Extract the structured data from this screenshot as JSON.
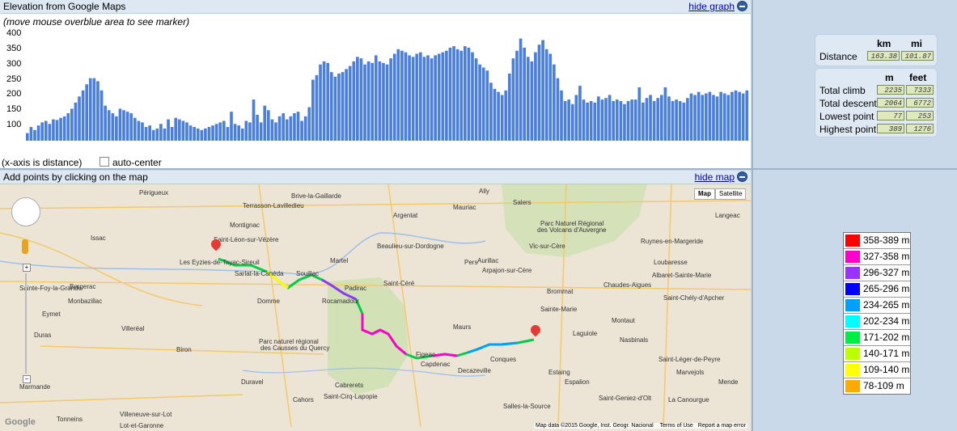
{
  "elevation": {
    "title": "Elevation from Google Maps",
    "hide_link": "hide graph",
    "hint": "(move mouse overblue area to see marker)",
    "y_ticks": [
      "400",
      "350",
      "300",
      "250",
      "200",
      "150",
      "100"
    ],
    "x_note": "(x-axis is distance)",
    "autocenter_label": "auto-center",
    "bar_color": "#4a7fe0",
    "chart_data": {
      "type": "bar",
      "ylim": [
        50,
        400
      ],
      "values": [
        75,
        95,
        85,
        100,
        110,
        115,
        105,
        120,
        118,
        125,
        130,
        140,
        155,
        175,
        195,
        215,
        235,
        255,
        255,
        245,
        215,
        165,
        150,
        140,
        130,
        155,
        150,
        145,
        140,
        125,
        115,
        110,
        95,
        100,
        85,
        90,
        105,
        90,
        120,
        95,
        125,
        120,
        115,
        110,
        100,
        95,
        90,
        85,
        90,
        95,
        100,
        105,
        110,
        115,
        95,
        145,
        105,
        100,
        90,
        115,
        110,
        185,
        135,
        110,
        165,
        150,
        120,
        110,
        130,
        140,
        120,
        130,
        140,
        145,
        115,
        130,
        160,
        250,
        265,
        300,
        310,
        305,
        275,
        260,
        270,
        275,
        285,
        295,
        310,
        325,
        320,
        300,
        310,
        305,
        330,
        310,
        305,
        300,
        320,
        335,
        350,
        345,
        340,
        330,
        325,
        335,
        340,
        325,
        330,
        320,
        330,
        335,
        340,
        345,
        355,
        360,
        350,
        345,
        360,
        355,
        340,
        320,
        300,
        290,
        280,
        240,
        220,
        210,
        200,
        215,
        270,
        320,
        345,
        385,
        355,
        325,
        310,
        340,
        365,
        380,
        350,
        335,
        300,
        255,
        215,
        180,
        185,
        170,
        200,
        230,
        185,
        175,
        180,
        175,
        195,
        185,
        190,
        200,
        180,
        185,
        180,
        170,
        180,
        185,
        185,
        225,
        175,
        190,
        200,
        180,
        190,
        200,
        225,
        195,
        180,
        185,
        180,
        175,
        190,
        205,
        200,
        210,
        200,
        205,
        210,
        200,
        195,
        210,
        205,
        200,
        210,
        215,
        210,
        205,
        215
      ]
    }
  },
  "stats": {
    "col_km": "km",
    "col_mi": "mi",
    "distance_label": "Distance",
    "distance_km": "163.38",
    "distance_mi": "101.87",
    "col_m": "m",
    "col_feet": "feet",
    "rows": [
      {
        "label": "Total climb",
        "m": "2235",
        "ft": "7333"
      },
      {
        "label": "Total descent",
        "m": "2064",
        "ft": "6772"
      },
      {
        "label": "Lowest point",
        "m": "77",
        "ft": "253"
      },
      {
        "label": "Highest point",
        "m": "389",
        "ft": "1276"
      }
    ]
  },
  "map": {
    "title": "Add points by clicking on the map",
    "hide_link": "hide map",
    "btn_map": "Map",
    "btn_satellite": "Satellite",
    "attribution": "Map data ©2015 Google, Inst. Geogr. Nacional",
    "terms": "Terms of Use",
    "report": "Report a map error",
    "google": "Google",
    "places": [
      {
        "name": "Périgueux",
        "x": 172,
        "y": 6
      },
      {
        "name": "Brive-la-Gaillarde",
        "x": 360,
        "y": 10
      },
      {
        "name": "Ally",
        "x": 592,
        "y": 4
      },
      {
        "name": "Salers",
        "x": 634,
        "y": 18
      },
      {
        "name": "Terrasson-Lavilledieu",
        "x": 300,
        "y": 22
      },
      {
        "name": "Argentat",
        "x": 486,
        "y": 34
      },
      {
        "name": "Mauriac",
        "x": 560,
        "y": 24
      },
      {
        "name": "Langeac",
        "x": 884,
        "y": 34
      },
      {
        "name": "Montignac",
        "x": 284,
        "y": 46
      },
      {
        "name": "Parc Naturel Régional",
        "x": 668,
        "y": 44
      },
      {
        "name": "des Volcans d'Auvergne",
        "x": 664,
        "y": 52
      },
      {
        "name": "Issac",
        "x": 112,
        "y": 62
      },
      {
        "name": "Saint-Léon-sur-Vézère",
        "x": 264,
        "y": 64
      },
      {
        "name": "Beaulieu-sur-Dordogne",
        "x": 466,
        "y": 72
      },
      {
        "name": "Vic-sur-Cère",
        "x": 654,
        "y": 72
      },
      {
        "name": "Ruynes-en-Margeride",
        "x": 792,
        "y": 66
      },
      {
        "name": "Les Eyzies-de-Tayac-Sireuil",
        "x": 222,
        "y": 92
      },
      {
        "name": "Sarlat-la-Canéda",
        "x": 290,
        "y": 106
      },
      {
        "name": "Martel",
        "x": 408,
        "y": 90
      },
      {
        "name": "Aurillac",
        "x": 590,
        "y": 90
      },
      {
        "name": "Arpajon-sur-Cère",
        "x": 596,
        "y": 102
      },
      {
        "name": "Loubaresse",
        "x": 808,
        "y": 92
      },
      {
        "name": "Souillac",
        "x": 366,
        "y": 106
      },
      {
        "name": "Pers",
        "x": 574,
        "y": 92
      },
      {
        "name": "Albaret-Sainte-Marie",
        "x": 806,
        "y": 108
      },
      {
        "name": "Bergerac",
        "x": 86,
        "y": 122
      },
      {
        "name": "Sainte-Foy-la-Grande",
        "x": 24,
        "y": 124
      },
      {
        "name": "Saint-Céré",
        "x": 474,
        "y": 118
      },
      {
        "name": "Padirac",
        "x": 426,
        "y": 124
      },
      {
        "name": "Chaudes-Aigues",
        "x": 746,
        "y": 120
      },
      {
        "name": "Monbazillac",
        "x": 84,
        "y": 140
      },
      {
        "name": "Domme",
        "x": 318,
        "y": 140
      },
      {
        "name": "Rocamadour",
        "x": 398,
        "y": 140
      },
      {
        "name": "Brommat",
        "x": 676,
        "y": 128
      },
      {
        "name": "Saint-Chély-d'Apcher",
        "x": 820,
        "y": 136
      },
      {
        "name": "Sainte-Marie",
        "x": 668,
        "y": 150
      },
      {
        "name": "Eymet",
        "x": 52,
        "y": 156
      },
      {
        "name": "Montaut",
        "x": 756,
        "y": 164
      },
      {
        "name": "Duras",
        "x": 42,
        "y": 182
      },
      {
        "name": "Villeréal",
        "x": 150,
        "y": 174
      },
      {
        "name": "Maurs",
        "x": 560,
        "y": 172
      },
      {
        "name": "Laguiole",
        "x": 708,
        "y": 180
      },
      {
        "name": "Nasbinals",
        "x": 766,
        "y": 188
      },
      {
        "name": "Parc naturel régional",
        "x": 320,
        "y": 190
      },
      {
        "name": "des Causses du Quercy",
        "x": 322,
        "y": 198
      },
      {
        "name": "Conques",
        "x": 606,
        "y": 212
      },
      {
        "name": "Biron",
        "x": 218,
        "y": 200
      },
      {
        "name": "Figeac",
        "x": 514,
        "y": 206
      },
      {
        "name": "Capdenac",
        "x": 520,
        "y": 218
      },
      {
        "name": "Decazeville",
        "x": 566,
        "y": 226
      },
      {
        "name": "Espalion",
        "x": 698,
        "y": 240
      },
      {
        "name": "Saint-Léger-de-Peyre",
        "x": 814,
        "y": 212
      },
      {
        "name": "Marvejols",
        "x": 836,
        "y": 228
      },
      {
        "name": "Marmande",
        "x": 24,
        "y": 246
      },
      {
        "name": "Duravel",
        "x": 298,
        "y": 240
      },
      {
        "name": "Estaing",
        "x": 678,
        "y": 228
      },
      {
        "name": "Mende",
        "x": 888,
        "y": 240
      },
      {
        "name": "Cabrerets",
        "x": 414,
        "y": 244
      },
      {
        "name": "Cahors",
        "x": 362,
        "y": 262
      },
      {
        "name": "Saint-Cirq-Lapopie",
        "x": 400,
        "y": 258
      },
      {
        "name": "Salles-la-Source",
        "x": 622,
        "y": 270
      },
      {
        "name": "Saint-Geniez-d'Olt",
        "x": 740,
        "y": 260
      },
      {
        "name": "La Canourgue",
        "x": 826,
        "y": 262
      },
      {
        "name": "Tonneins",
        "x": 70,
        "y": 286
      },
      {
        "name": "Villeneuve-sur-Lot",
        "x": 148,
        "y": 280
      },
      {
        "name": "Lot-et-Garonne",
        "x": 148,
        "y": 294
      }
    ]
  },
  "legend": {
    "items": [
      {
        "label": "358-389 m",
        "color": "#ff0000"
      },
      {
        "label": "327-358 m",
        "color": "#ff00cc"
      },
      {
        "label": "296-327 m",
        "color": "#9933ff"
      },
      {
        "label": "265-296 m",
        "color": "#0000ff"
      },
      {
        "label": "234-265 m",
        "color": "#00a0ff"
      },
      {
        "label": "202-234 m",
        "color": "#00ffff"
      },
      {
        "label": "171-202 m",
        "color": "#00ee44"
      },
      {
        "label": "140-171 m",
        "color": "#bbff00"
      },
      {
        "label": "109-140 m",
        "color": "#ffff00"
      },
      {
        "label": "78-109 m",
        "color": "#ffaa00"
      }
    ]
  }
}
